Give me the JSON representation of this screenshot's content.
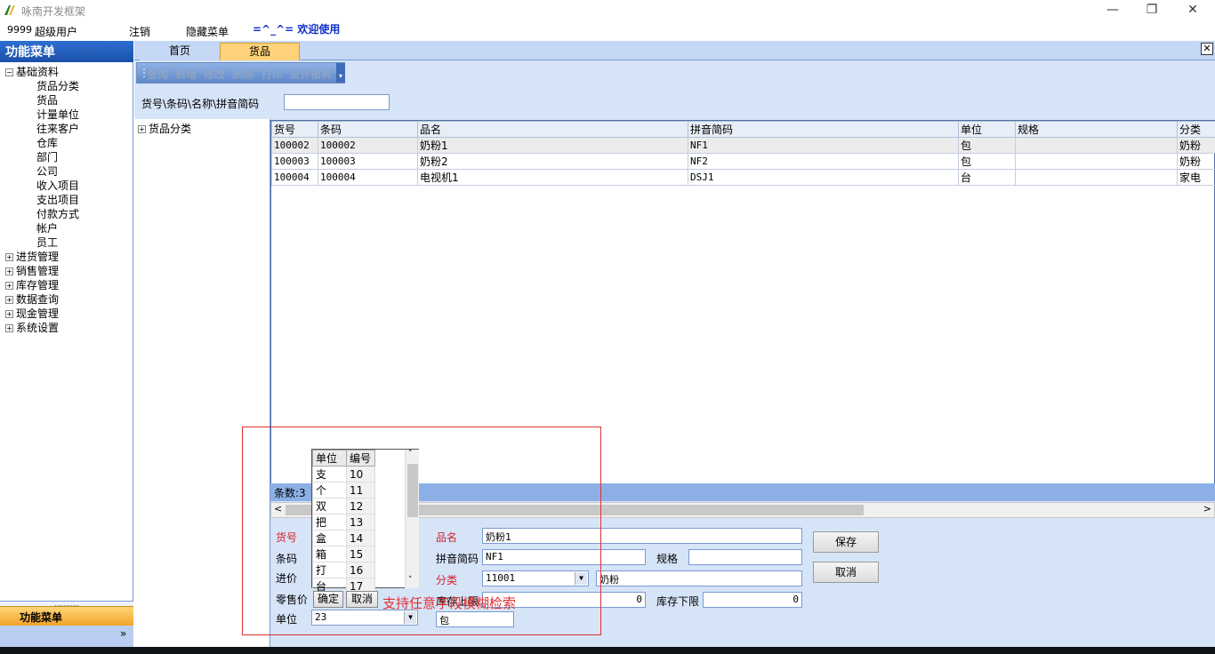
{
  "window": {
    "title": "咏南开发框架",
    "minimize": "—",
    "restore": "❐",
    "close": "✕"
  },
  "userbar": {
    "user_id": "9999",
    "user_name": "超级用户",
    "logout": "注销",
    "hide_menu": "隐藏菜单",
    "welcome": "=^_^= 欢迎使用"
  },
  "sidebar": {
    "title": "功能菜单",
    "root": "基础资料",
    "children": [
      "货品分类",
      "货品",
      "计量单位",
      "往来客户",
      "仓库",
      "部门",
      "公司",
      "收入项目",
      "支出项目",
      "付款方式",
      "帐户",
      "员工"
    ],
    "groups": [
      "进货管理",
      "销售管理",
      "库存管理",
      "数据查询",
      "现金管理",
      "系统设置"
    ],
    "footer_label": "功能菜单",
    "grip": "...........",
    "chevron": "»"
  },
  "tabs": {
    "home": "首页",
    "goods": "货品",
    "close": "✕"
  },
  "toolbar": {
    "query": "查询",
    "add": "新增",
    "edit": "修改",
    "delete": "删除",
    "print": "打印",
    "design": "设计报表"
  },
  "search": {
    "label": "货号\\条码\\名称\\拼音简码",
    "value": ""
  },
  "category_tree": {
    "root": "货品分类"
  },
  "grid": {
    "columns": [
      "货号",
      "条码",
      "品名",
      "拼音简码",
      "单位",
      "规格",
      "分类"
    ],
    "rows": [
      [
        "100002",
        "100002",
        "奶粉1",
        "NF1",
        "包",
        "",
        "奶粉"
      ],
      [
        "100003",
        "100003",
        "奶粉2",
        "NF2",
        "包",
        "",
        "奶粉"
      ],
      [
        "100004",
        "100004",
        "电视机1",
        "DSJ1",
        "台",
        "",
        "家电"
      ]
    ],
    "count_label": "条数:3"
  },
  "form": {
    "code_label": "货号",
    "barcode_label": "条码",
    "cost_label": "进价",
    "retail_label": "零售价",
    "unit_label": "单位",
    "unit_value": "23",
    "name_label": "品名",
    "name_value": "奶粉1",
    "pinyin_label": "拼音简码",
    "pinyin_value": "NF1",
    "spec_label": "规格",
    "spec_value": "",
    "category_label": "分类",
    "category_code": "11001",
    "category_name": "奶粉",
    "stock_upper_label": "库存上限",
    "stock_upper_value": "0",
    "stock_lower_label": "库存下限",
    "stock_lower_value": "0",
    "unit_name_value": "包",
    "save": "保存",
    "cancel": "取消"
  },
  "unit_popup": {
    "columns": [
      "单位",
      "编号"
    ],
    "rows": [
      [
        "支",
        "10"
      ],
      [
        "个",
        "11"
      ],
      [
        "双",
        "12"
      ],
      [
        "把",
        "13"
      ],
      [
        "盒",
        "14"
      ],
      [
        "箱",
        "15"
      ],
      [
        "打",
        "16"
      ],
      [
        "台",
        "17"
      ]
    ],
    "ok": "确定",
    "cancel": "取消"
  },
  "annotation": "支持任意字段模糊检索"
}
